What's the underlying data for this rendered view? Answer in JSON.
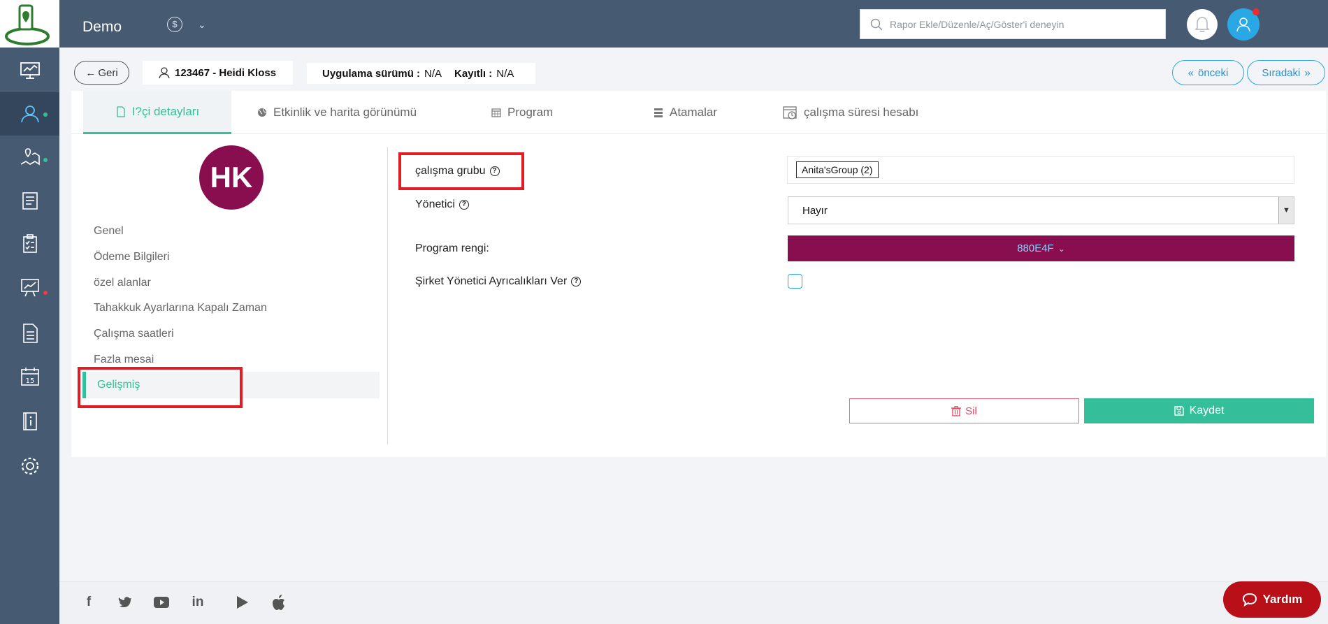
{
  "header": {
    "app_title": "Demo",
    "search_placeholder": "Rapor Ekle/Düzenle/Aç/Göster'i deneyin"
  },
  "subheader": {
    "back_label": "Geri",
    "employee": "123467 - Heidi Kloss",
    "app_version_label": "Uygulama sürümü :",
    "app_version_value": "N/A",
    "registered_label": "Kayıtlı :",
    "registered_value": "N/A",
    "prev_label": "önceki",
    "next_label": "Sıradaki"
  },
  "tabs": [
    {
      "label": "I?çi detayları",
      "icon": "document-icon",
      "active": true
    },
    {
      "label": "Etkinlik ve harita görünümü",
      "icon": "globe-icon"
    },
    {
      "label": "Program",
      "icon": "calendar-grid-icon"
    },
    {
      "label": "Atamalar",
      "icon": "list-stack-icon"
    },
    {
      "label": "çalışma süresi hesabı",
      "icon": "calendar-clock-icon"
    }
  ],
  "profile": {
    "initials": "HK",
    "avatar_color": "#880e4f"
  },
  "side_menu": [
    {
      "label": "Genel"
    },
    {
      "label": "Ödeme Bilgileri"
    },
    {
      "label": "özel alanlar"
    },
    {
      "label": "Tahakkuk Ayarlarına Kapalı Zaman"
    },
    {
      "label": "Çalışma saatleri"
    },
    {
      "label": "Fazla mesai"
    },
    {
      "label": "Gelişmiş",
      "active": true
    }
  ],
  "form": {
    "work_group_label": "çalışma grubu",
    "work_group_value": "Anita'sGroup (2)",
    "manager_label": "Yönetici",
    "manager_value": "Hayır",
    "program_color_label": "Program rengi:",
    "program_color_value": "880E4F",
    "company_admin_label": "Şirket Yönetici Ayrıcalıkları Ver",
    "company_admin_checked": false
  },
  "actions": {
    "delete_label": "Sil",
    "save_label": "Kaydet"
  },
  "help_button": "Yardım",
  "colors": {
    "accent": "#34bf9a",
    "sidebar": "#465a72",
    "highlight": "#e01c24",
    "program_color": "#880e4f"
  }
}
